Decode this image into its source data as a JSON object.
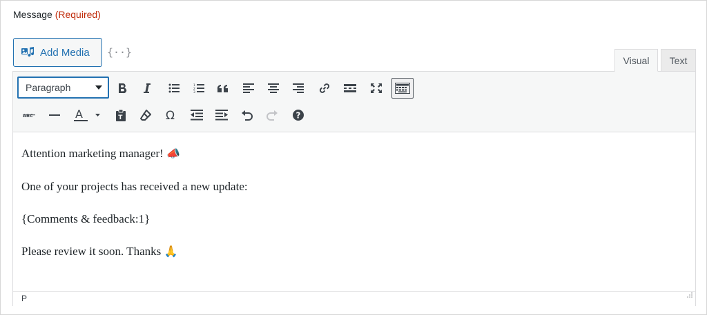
{
  "field": {
    "label": "Message",
    "required": "(Required)"
  },
  "media": {
    "add_label": "Add Media",
    "merge_tag_glyph": "{··}"
  },
  "tabs": [
    {
      "label": "Visual",
      "active": true
    },
    {
      "label": "Text",
      "active": false
    }
  ],
  "toolbar": {
    "format_select": "Paragraph",
    "row1": [
      "bold-icon",
      "italic-icon",
      "bulleted-list-icon",
      "numbered-list-icon",
      "blockquote-icon",
      "align-left-icon",
      "align-center-icon",
      "align-right-icon",
      "link-icon",
      "read-more-icon",
      "fullscreen-icon",
      "toolbar-toggle-icon"
    ],
    "row2": [
      "strikethrough-icon",
      "horizontal-line-icon",
      "text-color-icon",
      "paste-as-text-icon",
      "clear-formatting-icon",
      "special-character-icon",
      "outdent-icon",
      "indent-icon",
      "undo-icon",
      "redo-icon",
      "keyboard-shortcuts-icon"
    ]
  },
  "content": {
    "line1": "Attention marketing manager!",
    "line1_emoji": "📣",
    "line2": "One of your projects has received a new update:",
    "line3": "{Comments & feedback:1}",
    "line4": "Please review it soon. Thanks",
    "line4_emoji": "🙏"
  },
  "status": {
    "path": "P"
  },
  "colors": {
    "accent": "#2271b1",
    "required": "#c02b0a",
    "toolbar_bg": "#f6f7f7"
  }
}
